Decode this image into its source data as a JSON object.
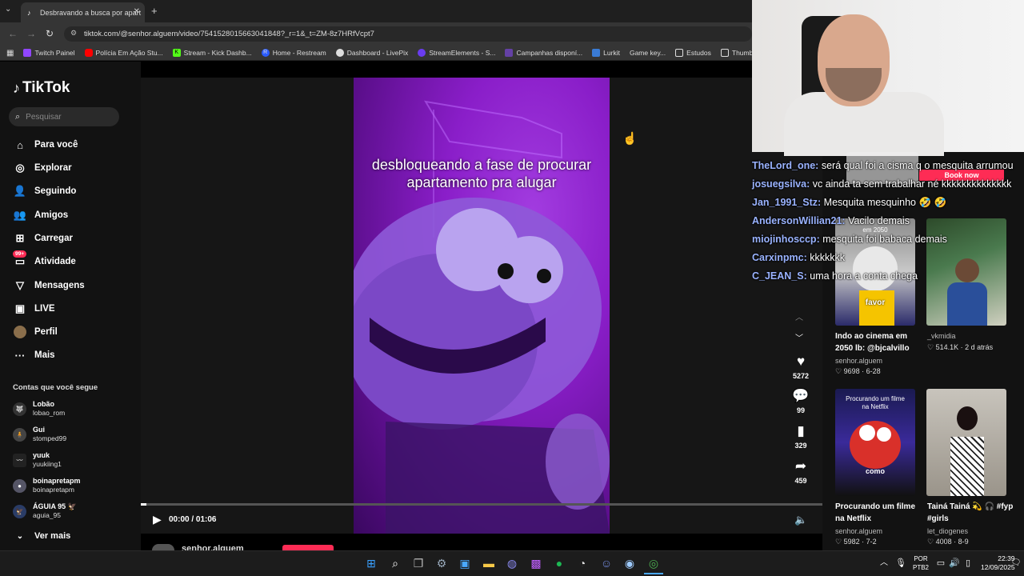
{
  "browser": {
    "tab_title": "Desbravando a busca por apart",
    "url": "tiktok.com/@senhor.alguem/video/7541528015663041848?_r=1&_t=ZM-8z7HRfVcpt7",
    "bookmarks": [
      "Twitch Painel",
      "Polícia Em Ação Stu...",
      "Stream - Kick Dashb...",
      "Home - Restream",
      "Dashboard - LivePix",
      "StreamElements - S...",
      "Campanhas disponí...",
      "Lurkit",
      "Game key...",
      "Estudos",
      "Thumbnails"
    ]
  },
  "sidebar": {
    "logo": "TikTok",
    "search_placeholder": "Pesquisar",
    "nav": [
      {
        "label": "Para você",
        "icon": "home-icon"
      },
      {
        "label": "Explorar",
        "icon": "compass-icon"
      },
      {
        "label": "Seguindo",
        "icon": "following-icon"
      },
      {
        "label": "Amigos",
        "icon": "friends-icon"
      },
      {
        "label": "Carregar",
        "icon": "upload-icon"
      },
      {
        "label": "Atividade",
        "icon": "activity-icon",
        "badge": "99+"
      },
      {
        "label": "Mensagens",
        "icon": "messages-icon"
      },
      {
        "label": "LIVE",
        "icon": "live-icon"
      },
      {
        "label": "Perfil",
        "icon": "profile-avatar"
      },
      {
        "label": "Mais",
        "icon": "more-icon"
      }
    ],
    "following_header": "Contas que você segue",
    "accounts": [
      {
        "name": "Lobão",
        "user": "lobao_rom"
      },
      {
        "name": "Gui",
        "user": "stomped99"
      },
      {
        "name": "yuuk",
        "user": "yuukiing1"
      },
      {
        "name": "boinapretapm",
        "user": "boinapretapm"
      },
      {
        "name": "ÁGUIA 95 🦅",
        "user": "aguia_95"
      }
    ],
    "see_more": "Ver mais"
  },
  "video": {
    "caption": "desbloqueando a fase de procurar apartamento pra alugar",
    "time": "00:00 / 01:06",
    "progress": 0.008,
    "author": "senhor.alguem",
    "likes": "5272",
    "comments": "99",
    "saves": "329",
    "shares": "459"
  },
  "recommended": [
    {
      "title": "Indo ao cinema em 2050 lb: @bjcalvillo",
      "user": "senhor.alguem",
      "views": "9698",
      "date": "6-28",
      "overlay": "favor",
      "top": "em 2050"
    },
    {
      "title": "_vkmidia",
      "user": "",
      "views": "514.1K",
      "date": "2 d atrás",
      "overlay": "",
      "top": ""
    },
    {
      "title": "Procurando um filme na Netflix",
      "user": "senhor.alguem",
      "views": "5982",
      "date": "7-2",
      "overlay": "como",
      "top": "Procurando um filme na Netflix"
    },
    {
      "title": "Tainá Tainá 💫 🎧 #fyp #girls",
      "user": "let_diogenes",
      "views": "4008",
      "date": "8-9",
      "overlay": "",
      "top": ""
    }
  ],
  "book_now": "Book now",
  "chat": [
    {
      "user": "TheLord_one:",
      "msg": "será qual foi a cisma q o mesquita arrumou"
    },
    {
      "user": "josuegsilva:",
      "msg": "vc ainda ta sem trabalhar né kkkkkkkkkkkkkk"
    },
    {
      "user": "Jan_1991_Stz:",
      "msg": "Mesquita mesquinho 🤣 🤣"
    },
    {
      "user": "AndersonWillian21:",
      "msg": "Vacilo demais"
    },
    {
      "user": "miojinhosccp:",
      "msg": "mesquita foi babaca demais"
    },
    {
      "user": "Carxinpmc:",
      "msg": "kkkkkkk"
    },
    {
      "user": "C_JEAN_S:",
      "msg": "uma hora a conta chega"
    }
  ],
  "taskbar": {
    "lang": "POR",
    "lang2": "PTB2",
    "time": "22:39",
    "date": "12/09/2025"
  },
  "colors": {
    "accent": "#fe2c55",
    "video_purple": "#8a1ec9",
    "chat_user": "#9ab3ff"
  }
}
